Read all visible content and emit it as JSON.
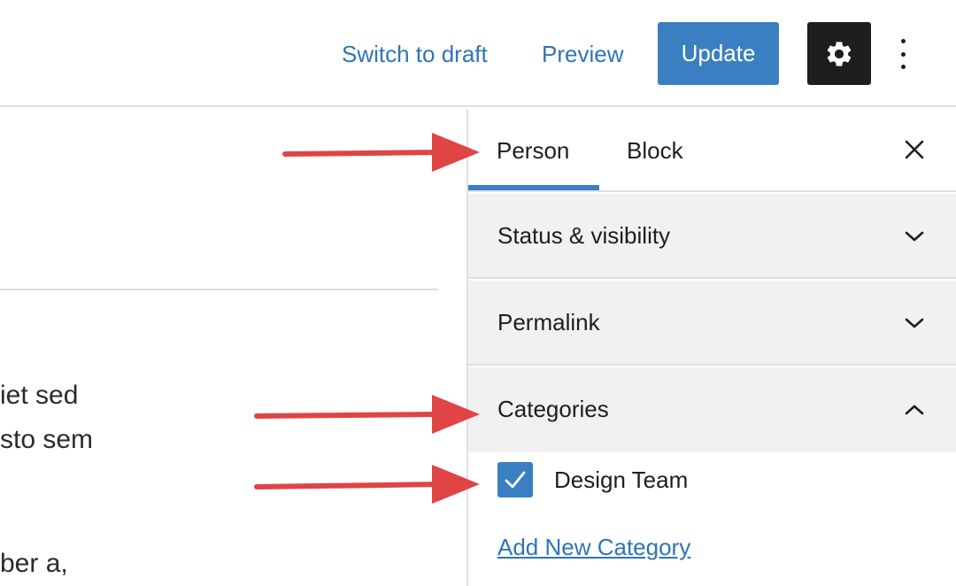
{
  "toolbar": {
    "switch_to_draft_label": "Switch to draft",
    "preview_label": "Preview",
    "update_label": "Update",
    "settings_icon": "gear-icon",
    "more_icon": "vertical-ellipsis-icon"
  },
  "editor": {
    "text_fragments": [
      "iet sed",
      "sto sem",
      "ber a,"
    ]
  },
  "sidebar": {
    "tabs": [
      {
        "label": "Person",
        "active": true
      },
      {
        "label": "Block",
        "active": false
      }
    ],
    "close_icon": "close-icon",
    "panels": [
      {
        "title": "Status & visibility",
        "expanded": false
      },
      {
        "title": "Permalink",
        "expanded": false
      },
      {
        "title": "Categories",
        "expanded": true
      }
    ],
    "categories": [
      {
        "label": "Design Team",
        "checked": true
      }
    ],
    "add_new_category_label": "Add New Category"
  },
  "colors": {
    "accent": "#3a7fc1",
    "link": "#2f75b5",
    "annotation_arrow": "#e04444",
    "dark_button": "#1e1e1e",
    "panel_bg": "#f1f1f3"
  }
}
